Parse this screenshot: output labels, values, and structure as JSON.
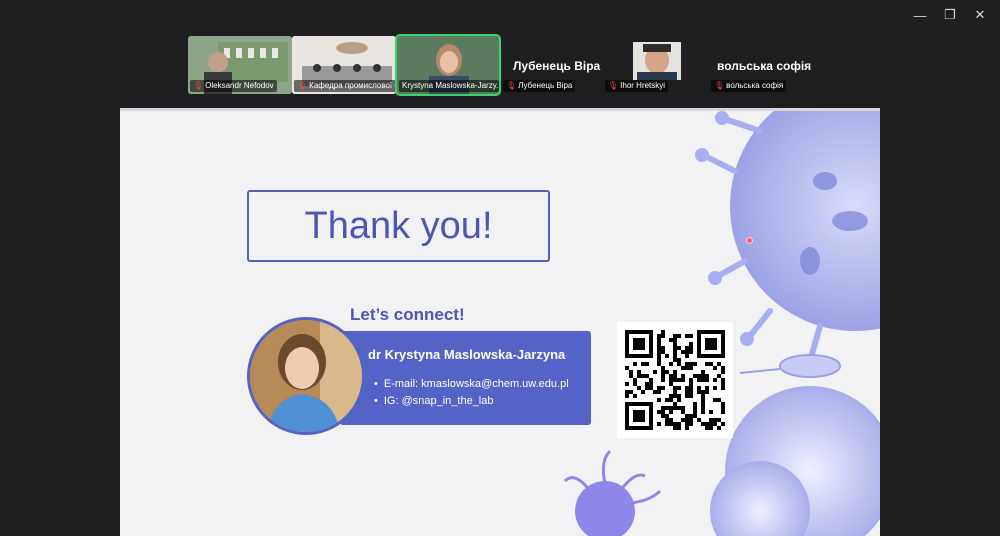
{
  "window": {
    "controls": {
      "minimize": "—",
      "restore": "❐",
      "close": "✕"
    }
  },
  "participants": [
    {
      "name": "Oleksandr Nefodov",
      "muted": true
    },
    {
      "name": "Кафедра промислової фа...",
      "muted": true
    },
    {
      "name": "Krystyna Maslowska-Jarzy...",
      "muted": false,
      "active": true
    },
    {
      "name": "Лубенець Віра",
      "muted": true,
      "display_name": "Лубенець Віра"
    },
    {
      "name": "Ihor Hretskyi",
      "muted": true
    },
    {
      "name": "вольська софія",
      "muted": true,
      "display_name": "вольська софія"
    }
  ],
  "slide": {
    "title": "Thank you!",
    "connect": "Let’s connect!",
    "card": {
      "name": "dr Krystyna Maslowska-Jarzyna",
      "email": "E-mail: kmaslowska@chem.uw.edu.pl",
      "ig": "IG: @snap_in_the_lab"
    },
    "colors": {
      "accent": "#5562c6",
      "title": "#4d56b0",
      "background": "#f2f2f4"
    }
  }
}
